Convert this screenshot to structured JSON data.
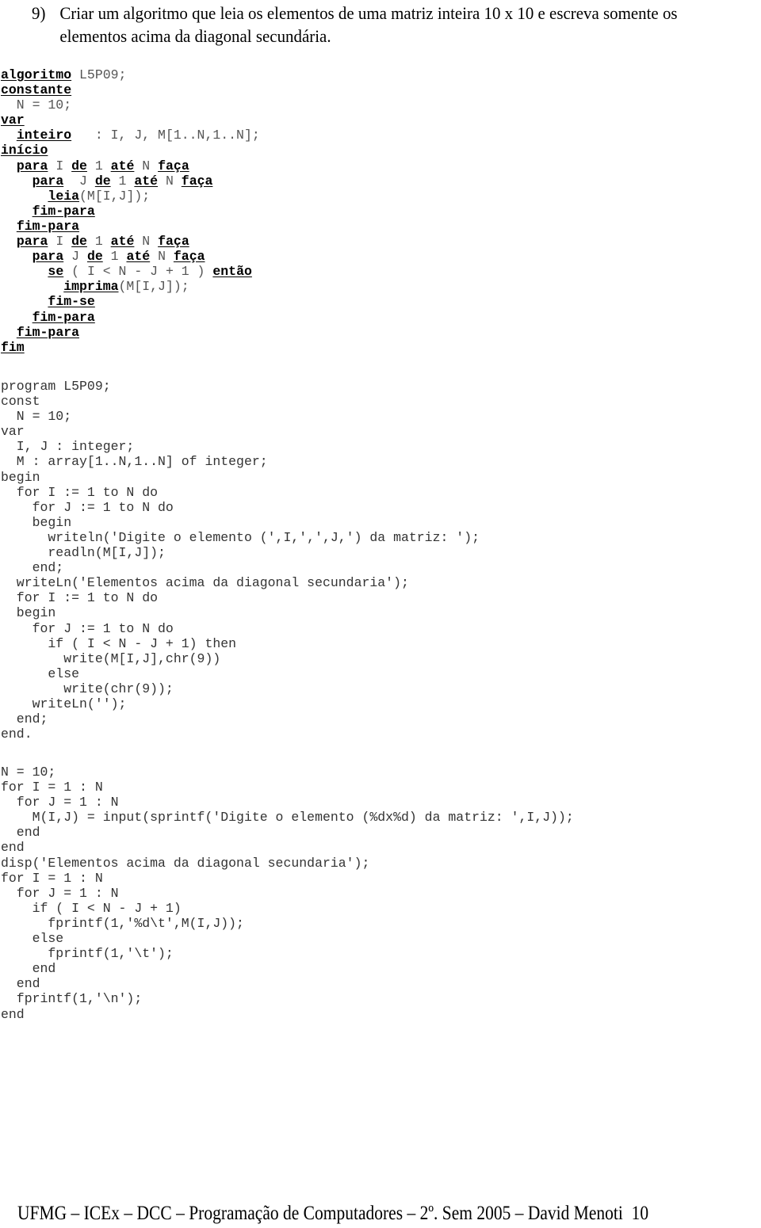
{
  "exercise": {
    "number": "9)",
    "statement": "Criar um algoritmo que leia os elementos de uma matriz inteira 10 x 10 e escreva somente os elementos acima da diagonal secundária."
  },
  "algorithm": {
    "lines": [
      [
        {
          "t": "algoritmo",
          "k": true
        },
        {
          "t": " L5P09;"
        }
      ],
      [
        {
          "t": "constante",
          "k": true
        }
      ],
      [
        {
          "t": "  N = 10;"
        }
      ],
      [
        {
          "t": "var",
          "k": true
        }
      ],
      [
        {
          "t": "  "
        },
        {
          "t": "inteiro",
          "k": true
        },
        {
          "t": "   : I, J, M[1..N,1..N];"
        }
      ],
      [
        {
          "t": "início",
          "k": true
        }
      ],
      [
        {
          "t": "  "
        },
        {
          "t": "para",
          "k": true
        },
        {
          "t": " I "
        },
        {
          "t": "de",
          "k": true
        },
        {
          "t": " 1 "
        },
        {
          "t": "até",
          "k": true
        },
        {
          "t": " N "
        },
        {
          "t": "faça",
          "k": true
        }
      ],
      [
        {
          "t": "    "
        },
        {
          "t": "para",
          "k": true
        },
        {
          "t": "  J "
        },
        {
          "t": "de",
          "k": true
        },
        {
          "t": " 1 "
        },
        {
          "t": "até",
          "k": true
        },
        {
          "t": " N "
        },
        {
          "t": "faça",
          "k": true
        }
      ],
      [
        {
          "t": "      "
        },
        {
          "t": "leia",
          "k": true
        },
        {
          "t": "(M[I,J]);"
        }
      ],
      [
        {
          "t": "    "
        },
        {
          "t": "fim-para",
          "k": true
        }
      ],
      [
        {
          "t": "  "
        },
        {
          "t": "fim-para",
          "k": true
        }
      ],
      [
        {
          "t": "  "
        },
        {
          "t": "para",
          "k": true
        },
        {
          "t": " I "
        },
        {
          "t": "de",
          "k": true
        },
        {
          "t": " 1 "
        },
        {
          "t": "até",
          "k": true
        },
        {
          "t": " N "
        },
        {
          "t": "faça",
          "k": true
        }
      ],
      [
        {
          "t": "    "
        },
        {
          "t": "para",
          "k": true
        },
        {
          "t": " J "
        },
        {
          "t": "de",
          "k": true
        },
        {
          "t": " 1 "
        },
        {
          "t": "até",
          "k": true
        },
        {
          "t": " N "
        },
        {
          "t": "faça",
          "k": true
        }
      ],
      [
        {
          "t": "      "
        },
        {
          "t": "se",
          "k": true
        },
        {
          "t": " ( I < N - J + 1 ) "
        },
        {
          "t": "então",
          "k": true
        }
      ],
      [
        {
          "t": "        "
        },
        {
          "t": "imprima",
          "k": true
        },
        {
          "t": "(M[I,J]);"
        }
      ],
      [
        {
          "t": "      "
        },
        {
          "t": "fim-se",
          "k": true
        }
      ],
      [
        {
          "t": "    "
        },
        {
          "t": "fim-para",
          "k": true
        }
      ],
      [
        {
          "t": "  "
        },
        {
          "t": "fim-para",
          "k": true
        }
      ],
      [
        {
          "t": "fim",
          "k": true
        }
      ]
    ]
  },
  "pascal": {
    "lines": [
      "program L5P09;",
      "const",
      "  N = 10;",
      "var",
      "  I, J : integer;",
      "  M : array[1..N,1..N] of integer;",
      "begin",
      "  for I := 1 to N do",
      "    for J := 1 to N do",
      "    begin",
      "      writeln('Digite o elemento (',I,',',J,') da matriz: ');",
      "      readln(M[I,J]);",
      "    end;",
      "  writeLn('Elementos acima da diagonal secundaria');",
      "  for I := 1 to N do",
      "  begin",
      "    for J := 1 to N do",
      "      if ( I < N - J + 1) then",
      "        write(M[I,J],chr(9))",
      "      else",
      "        write(chr(9));",
      "    writeLn('');",
      "  end;",
      "end."
    ]
  },
  "matlab": {
    "lines": [
      "N = 10;",
      "for I = 1 : N",
      "  for J = 1 : N",
      "    M(I,J) = input(sprintf('Digite o elemento (%dx%d) da matriz: ',I,J));",
      "  end",
      "end",
      "disp('Elementos acima da diagonal secundaria');",
      "for I = 1 : N",
      "  for J = 1 : N",
      "    if ( I < N - J + 1)",
      "      fprintf(1,'%d\\t',M(I,J));",
      "    else",
      "      fprintf(1,'\\t');",
      "    end",
      "  end",
      "  fprintf(1,'\\n');",
      "end"
    ]
  },
  "footer": {
    "text": "UFMG – ICEx – DCC – Programação de Computadores – 2º. Sem 2005 – David Menoti",
    "page_number": "10"
  }
}
